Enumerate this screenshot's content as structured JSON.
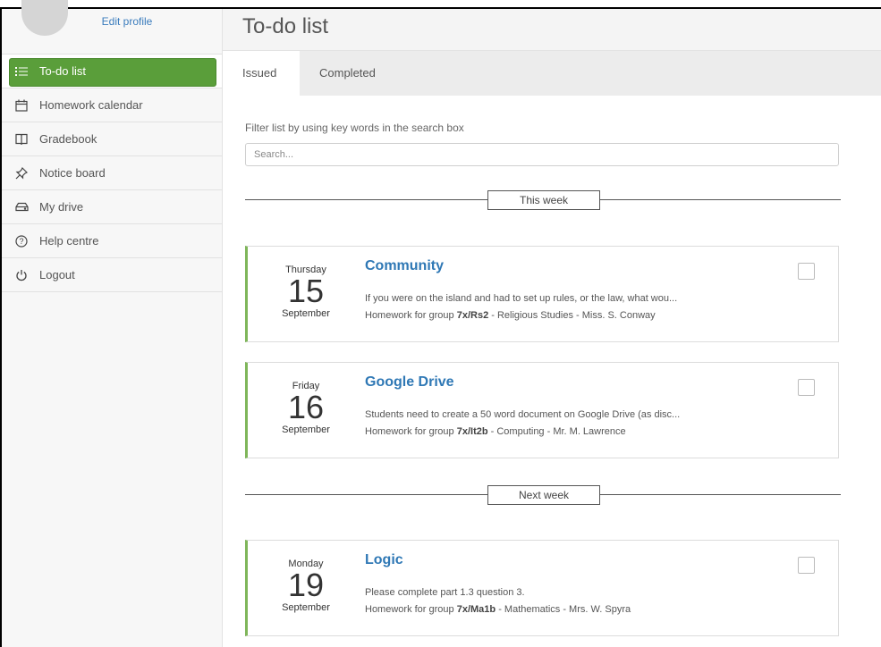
{
  "sidebar": {
    "edit_profile": "Edit profile",
    "items": [
      {
        "label": "To-do list",
        "icon": "list-icon",
        "active": true
      },
      {
        "label": "Homework calendar",
        "icon": "calendar-icon"
      },
      {
        "label": "Gradebook",
        "icon": "book-icon"
      },
      {
        "label": "Notice board",
        "icon": "pin-icon"
      },
      {
        "label": "My drive",
        "icon": "drive-icon"
      },
      {
        "label": "Help centre",
        "icon": "help-icon"
      },
      {
        "label": "Logout",
        "icon": "power-icon"
      }
    ]
  },
  "header": {
    "title": "To-do list"
  },
  "tabs": [
    {
      "label": "Issued",
      "active": true
    },
    {
      "label": "Completed"
    }
  ],
  "filter": {
    "label": "Filter list by using key words in the search box",
    "placeholder": "Search...",
    "value": ""
  },
  "sections": [
    {
      "label": "This week"
    },
    {
      "label": "Next week"
    }
  ],
  "tasks": [
    {
      "weekday": "Thursday",
      "day": "15",
      "month": "September",
      "title": "Community",
      "description": "If you were on the island and had to set up rules, or the law, what wou...",
      "meta_prefix": "Homework for group ",
      "group": "7x/Rs2",
      "meta_suffix": " - Religious Studies - Miss. S. Conway",
      "checked": false
    },
    {
      "weekday": "Friday",
      "day": "16",
      "month": "September",
      "title": "Google Drive",
      "description": "Students need to create a 50 word document on Google Drive (as disc...",
      "meta_prefix": "Homework for group ",
      "group": "7x/It2b",
      "meta_suffix": " - Computing - Mr. M. Lawrence",
      "checked": false
    },
    {
      "weekday": "Monday",
      "day": "19",
      "month": "September",
      "title": "Logic",
      "description": "Please complete part 1.3 question 3.",
      "meta_prefix": "Homework for group ",
      "group": "7x/Ma1b",
      "meta_suffix": " - Mathematics - Mrs. W. Spyra",
      "checked": false
    }
  ],
  "colors": {
    "accent_green": "#5a9e3a",
    "card_border": "#7fb65a",
    "title_blue": "#2f78b5"
  }
}
